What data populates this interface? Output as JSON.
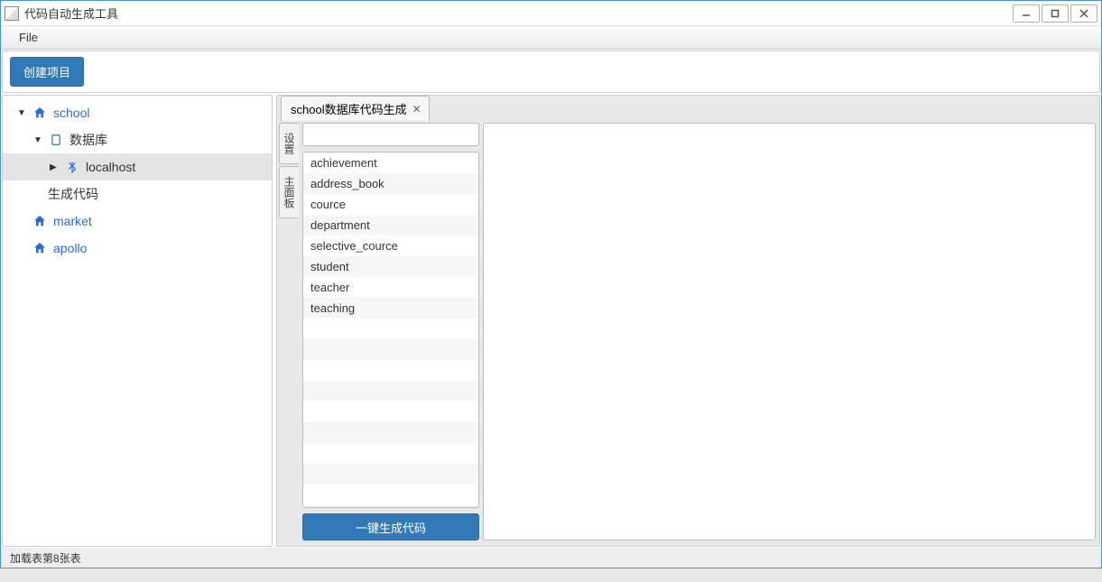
{
  "window": {
    "title": "代码自动生成工具"
  },
  "menubar": {
    "file": "File"
  },
  "toolbar": {
    "create_project": "创建项目"
  },
  "sidebar": {
    "items": [
      {
        "label": "school",
        "icon": "home",
        "level": 1,
        "expanded": true
      },
      {
        "label": "数据库",
        "icon": "db",
        "level": 2,
        "expanded": true
      },
      {
        "label": "localhost",
        "icon": "bt",
        "level": 3,
        "collapsed": true,
        "selected": true
      },
      {
        "label": "生成代码",
        "icon": "",
        "level": 2
      },
      {
        "label": "market",
        "icon": "home",
        "level": 1
      },
      {
        "label": "apollo",
        "icon": "home",
        "level": 1
      }
    ]
  },
  "tabs": {
    "items": [
      {
        "label": "school数据库代码生成"
      }
    ]
  },
  "vertical_tabs": {
    "settings": "设置",
    "main_panel": "主面板"
  },
  "tables": {
    "items": [
      "achievement",
      "address_book",
      "cource",
      "department",
      "selective_cource",
      "student",
      "teacher",
      "teaching"
    ]
  },
  "actions": {
    "generate": "一键生成代码"
  },
  "statusbar": {
    "text": "加载表第8张表"
  }
}
